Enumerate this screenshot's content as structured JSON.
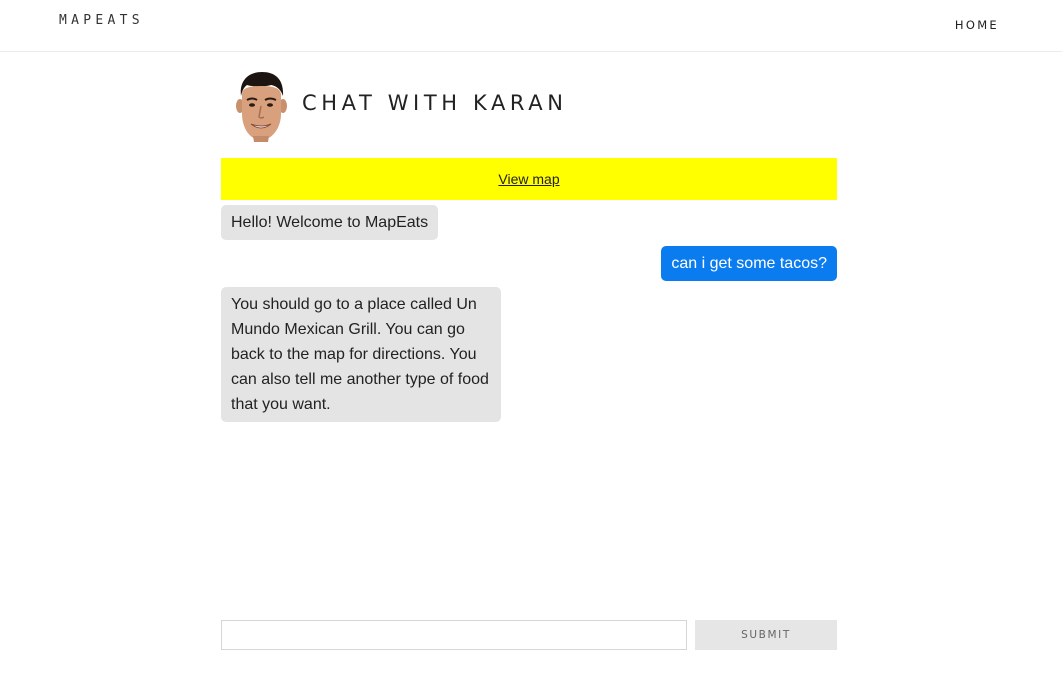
{
  "header": {
    "brand": "MAPEATS",
    "nav": {
      "home_label": "HOME"
    }
  },
  "chat": {
    "title": "CHAT WITH KARAN",
    "avatar_icon": "person-face-avatar"
  },
  "map_banner": {
    "link_label": "View map",
    "background_color": "#ffff00"
  },
  "messages": [
    {
      "sender": "bot",
      "text": "Hello! Welcome to MapEats"
    },
    {
      "sender": "user",
      "text": "can i get some tacos?"
    },
    {
      "sender": "bot",
      "text": "You should go to a place called Un Mundo Mexican Grill. You can go back to the map for directions. You can also tell me another type of food that you want."
    }
  ],
  "composer": {
    "input_value": "",
    "input_placeholder": "",
    "submit_label": "SUBMIT"
  },
  "colors": {
    "user_bubble": "#0a7cf0",
    "bot_bubble": "#e4e4e4"
  }
}
